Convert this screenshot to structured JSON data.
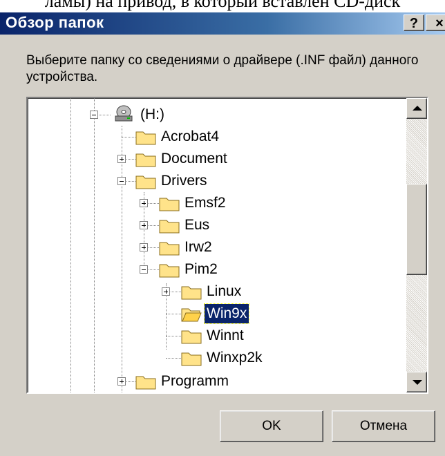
{
  "document": {
    "text_fragment": "ламы) на привод, в который вставлен CD-диск"
  },
  "dialog": {
    "title": "Обзор папок",
    "help_label": "?",
    "close_label": "×",
    "instruction": "Выберите папку со сведениями о драйвере (.INF файл) данного устройства.",
    "ok_label": "OK",
    "cancel_label": "Отмена"
  },
  "tree": {
    "items": [
      {
        "label": "(H:)",
        "icon": "cd-drive-icon",
        "expanded": true
      },
      {
        "label": "Acrobat4",
        "icon": "folder-icon"
      },
      {
        "label": "Document",
        "icon": "folder-icon",
        "expanded": false
      },
      {
        "label": "Drivers",
        "icon": "folder-icon",
        "expanded": true
      },
      {
        "label": "Emsf2",
        "icon": "folder-icon",
        "expanded": false
      },
      {
        "label": "Eus",
        "icon": "folder-icon",
        "expanded": false
      },
      {
        "label": "Irw2",
        "icon": "folder-icon",
        "expanded": false
      },
      {
        "label": "Pim2",
        "icon": "folder-icon",
        "expanded": true
      },
      {
        "label": "Linux",
        "icon": "folder-icon",
        "expanded": false
      },
      {
        "label": "Win9x",
        "icon": "open-folder-icon",
        "selected": true
      },
      {
        "label": "Winnt",
        "icon": "folder-icon"
      },
      {
        "label": "Winxp2k",
        "icon": "folder-icon"
      },
      {
        "label": "Programm",
        "icon": "folder-icon",
        "expanded": false
      }
    ]
  },
  "colors": {
    "selection": "#0a246a",
    "dialog_face": "#d4d0c8",
    "title_start": "#0a246a"
  }
}
